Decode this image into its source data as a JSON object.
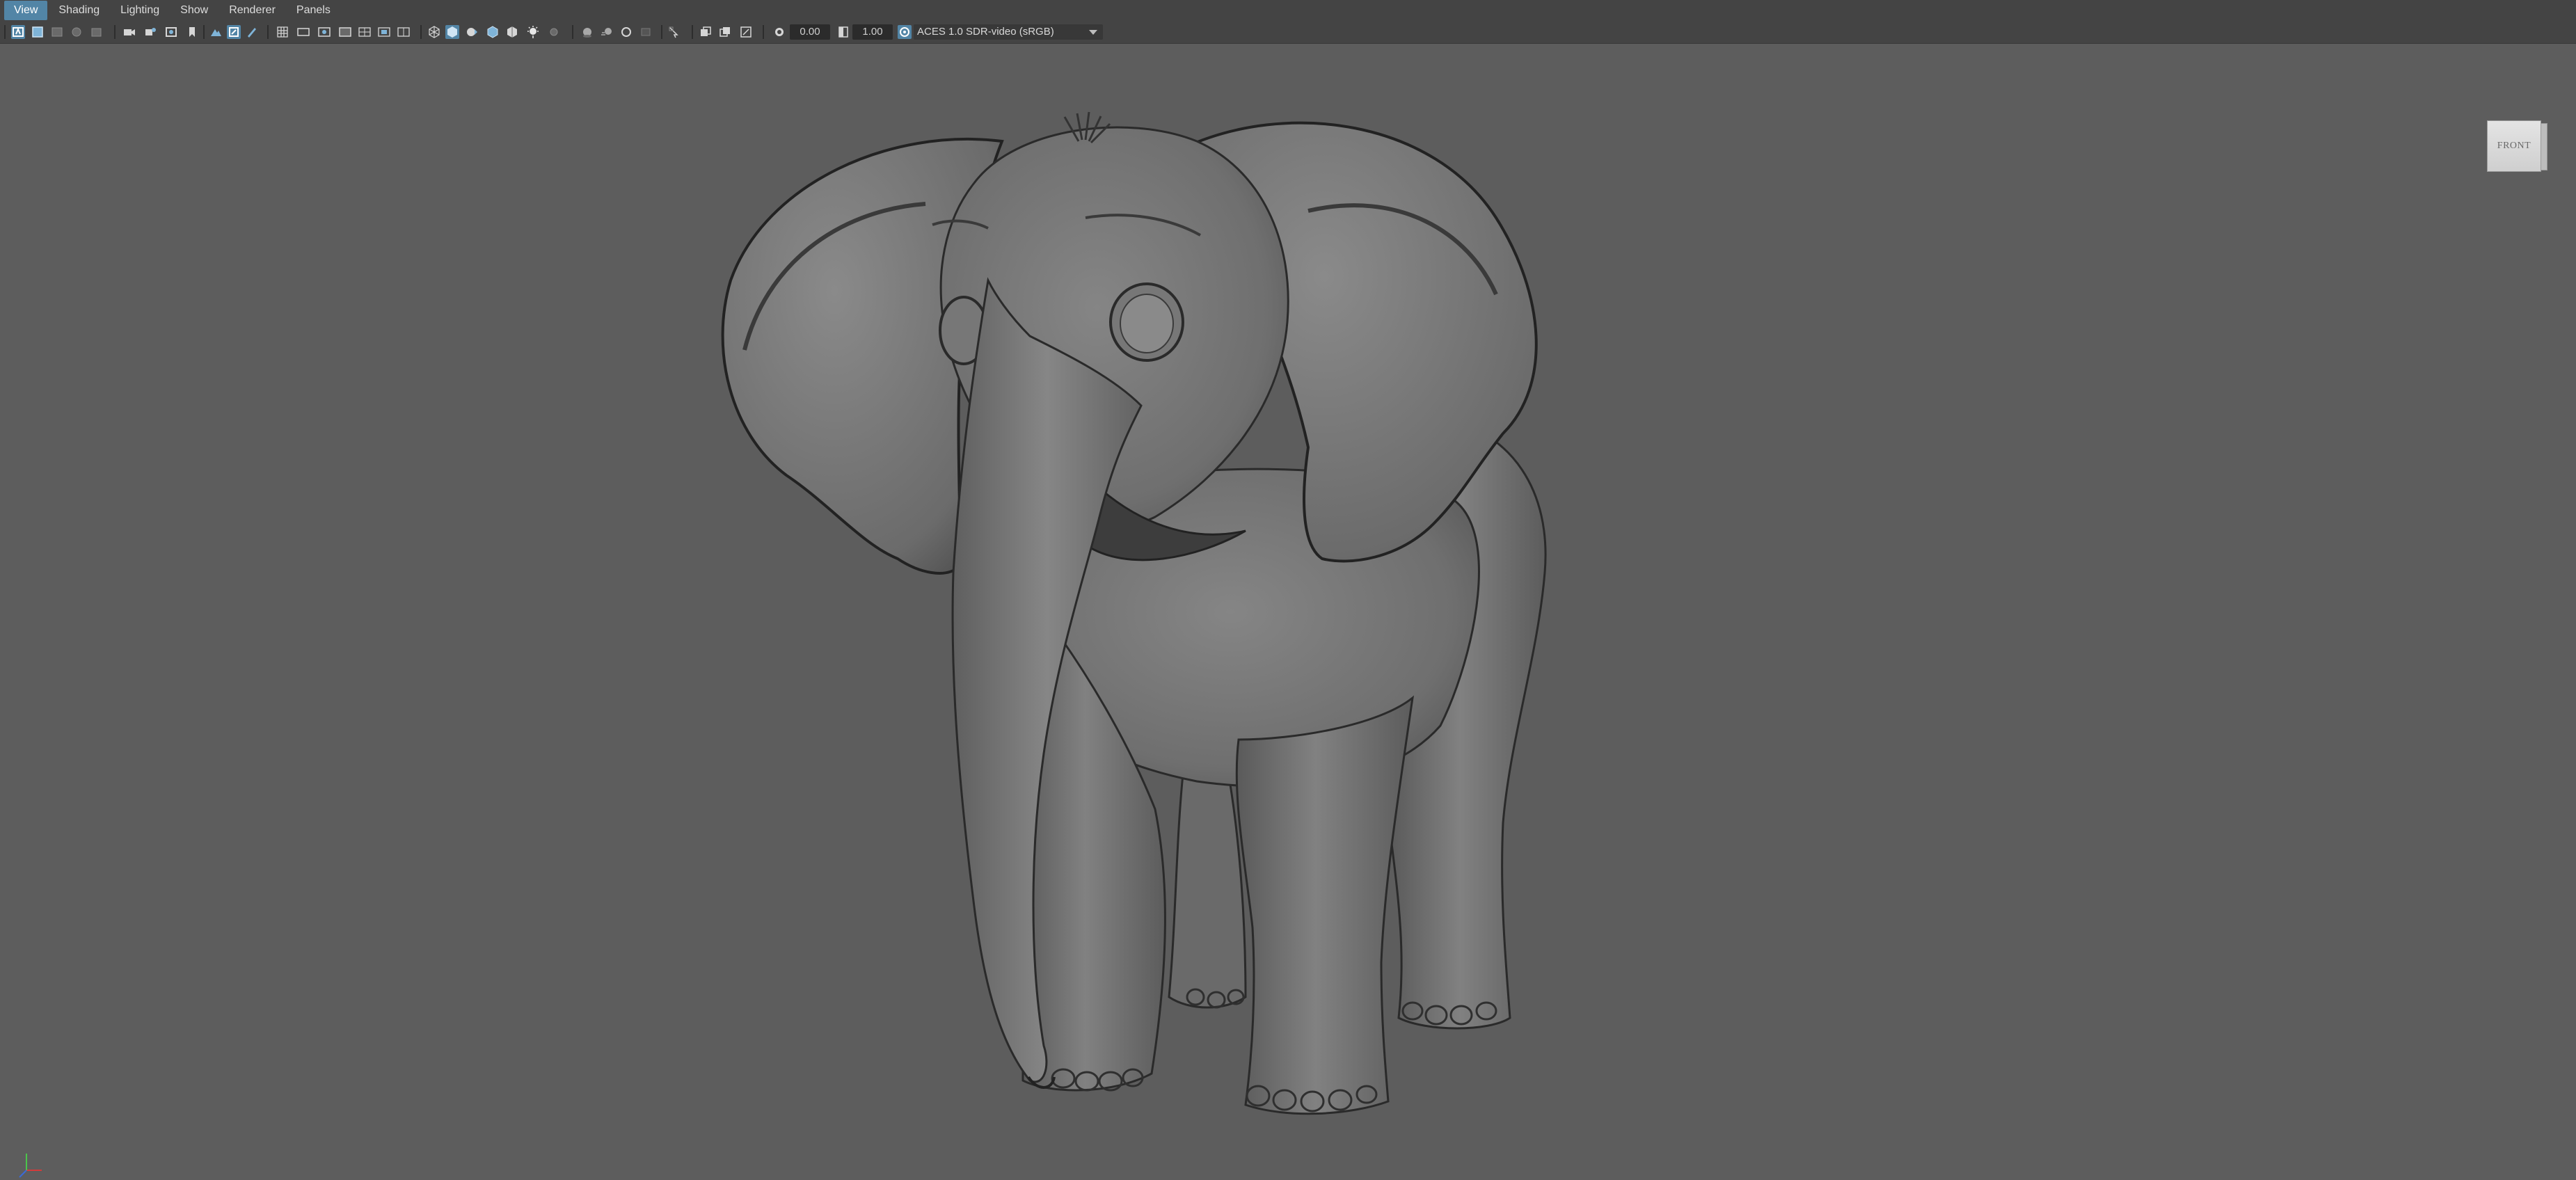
{
  "menubar": {
    "items": [
      {
        "label": "View",
        "active": true
      },
      {
        "label": "Shading"
      },
      {
        "label": "Lighting"
      },
      {
        "label": "Show"
      },
      {
        "label": "Renderer"
      },
      {
        "label": "Panels"
      }
    ]
  },
  "toolbar": {
    "exposure_value": "0.00",
    "gamma_value": "1.00",
    "color_management_label": "ACES 1.0 SDR-video (sRGB)",
    "accent_color": "#5285a6",
    "icons": [
      "select-camera-icon",
      "lock-camera-icon",
      "camera-attributes-icon",
      "bookmarks-icon",
      "image-plane-icon",
      "2d-pan-zoom-icon",
      "grease-pencil-icon",
      "grid-icon",
      "film-gate-icon",
      "resolution-gate-icon",
      "gate-mask-icon",
      "field-chart-icon",
      "safe-action-icon",
      "safe-title-icon",
      "wireframe-icon",
      "smooth-shade-icon",
      "default-material-icon",
      "wireframe-on-shaded-icon",
      "textured-icon",
      "use-all-lights-icon",
      "shadows-icon",
      "screen-space-ao-icon",
      "motion-blur-icon",
      "multisample-aa-icon",
      "depth-of-field-icon",
      "isolate-select-icon",
      "xray-icon",
      "xray-joints-icon",
      "xray-components-icon",
      "exposure-icon",
      "gamma-icon",
      "color-management-icon"
    ]
  },
  "viewport": {
    "background_color": "#5d5d5d",
    "model_color": "#7b7b7b",
    "view_cube_label": "FRONT"
  },
  "axis_indicator": {
    "x_color": "#d43a3a",
    "y_color": "#4bc44b",
    "z_color": "#3a6ad8"
  }
}
